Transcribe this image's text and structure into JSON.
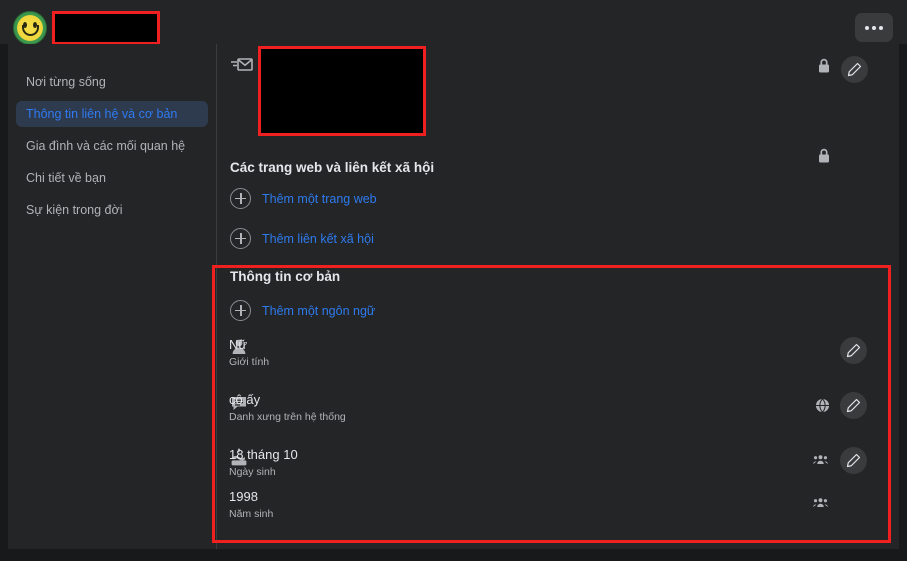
{
  "topbar": {
    "avatar_alt": "smiley-avatar",
    "name_redacted": "",
    "more_label": ""
  },
  "sidebar": {
    "items": [
      {
        "label": "Nơi từng sống",
        "active": false
      },
      {
        "label": "Thông tin liên hệ và cơ bản",
        "active": true
      },
      {
        "label": "Gia đình và các mối quan hệ",
        "active": false
      },
      {
        "label": "Chi tiết về bạn",
        "active": false
      },
      {
        "label": "Sự kiện trong đời",
        "active": false
      }
    ]
  },
  "contact": {
    "email_redacted": "",
    "privacy_1": "lock-icon",
    "privacy_2": "lock-icon"
  },
  "websites": {
    "title": "Các trang web và liên kết xã hội",
    "add_website": "Thêm một trang web",
    "add_social": "Thêm liên kết xã hội"
  },
  "basic_info": {
    "title": "Thông tin cơ bản",
    "add_language": "Thêm một ngôn ngữ",
    "rows": [
      {
        "icon": "person-icon",
        "value": "Nữ",
        "sublabel": "Giới tính",
        "privacy": "",
        "editable": true
      },
      {
        "icon": "speech-bubble-icon",
        "value": "cô ấy",
        "sublabel": "Danh xưng trên hệ thống",
        "privacy": "globe-icon",
        "editable": true
      },
      {
        "icon": "cake-icon",
        "value": "18 tháng 10",
        "sublabel": "Ngày sinh",
        "privacy": "friends-icon",
        "editable": true
      },
      {
        "icon": "",
        "value": "1998",
        "sublabel": "Năm sinh",
        "privacy": "friends-icon",
        "editable": false
      }
    ]
  },
  "colors": {
    "accent_blue": "#2e7bf0",
    "panel": "#242526",
    "page_bg": "#18191a",
    "annotation_red": "#f02020"
  }
}
